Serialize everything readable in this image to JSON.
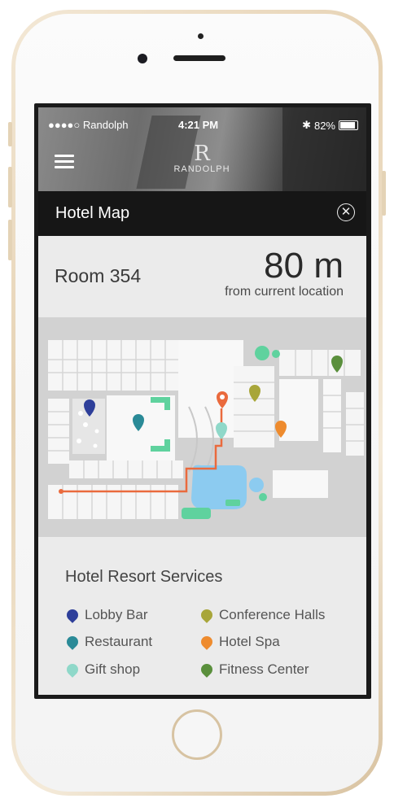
{
  "status_bar": {
    "carrier": "●●●●○ Randolph",
    "time": "4:21 PM",
    "battery": "82%"
  },
  "brand": {
    "mark": "R",
    "name": "RANDOLPH"
  },
  "header": {
    "title": "Hotel Map"
  },
  "room": {
    "label": "Room 354",
    "distance": "80 m",
    "distance_sub": "from current location"
  },
  "services": {
    "title": "Hotel Resort Services",
    "items": [
      {
        "label": "Lobby Bar",
        "color": "#2e3f9a",
        "icon": "map-pin-icon"
      },
      {
        "label": "Restaurant",
        "color": "#2a8a97",
        "icon": "map-pin-icon"
      },
      {
        "label": "Gift shop",
        "color": "#8fd8c9",
        "icon": "map-pin-icon"
      },
      {
        "label": "Conference Halls",
        "color": "#a8a63a",
        "icon": "map-pin-icon"
      },
      {
        "label": "Hotel Spa",
        "color": "#ee8b2e",
        "icon": "map-pin-icon"
      },
      {
        "label": "Fitness Center",
        "color": "#5a8f3c",
        "icon": "map-pin-icon"
      }
    ]
  },
  "colors": {
    "route": "#ea6a3d",
    "pool": "#8ccbf0",
    "garden": "#5fd29e"
  }
}
